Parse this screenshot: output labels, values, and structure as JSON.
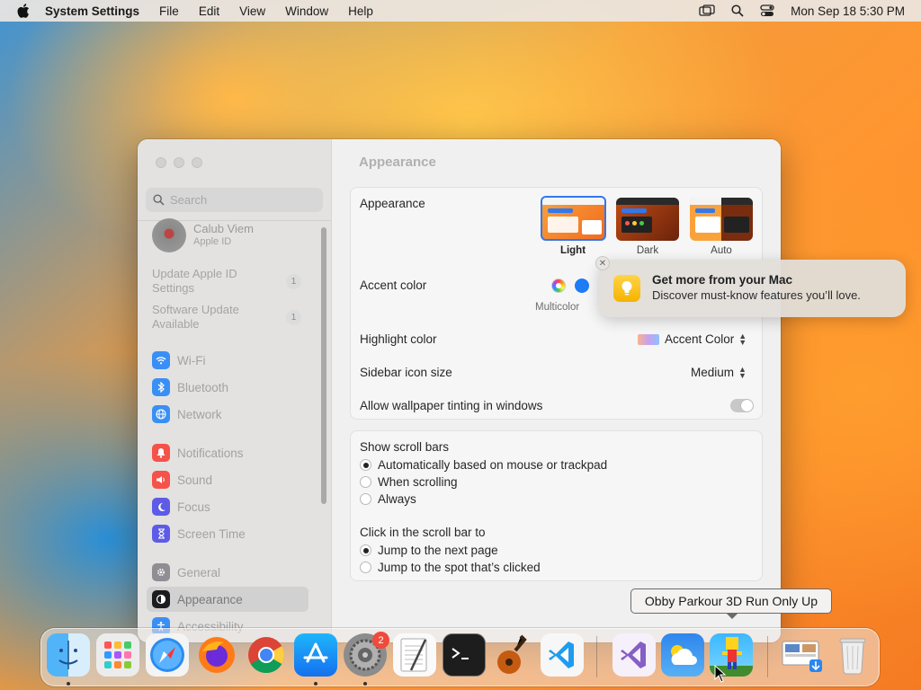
{
  "menubar": {
    "app_name": "System Settings",
    "menus": [
      "File",
      "Edit",
      "View",
      "Window",
      "Help"
    ],
    "clock": "Mon Sep 18  5:30 PM"
  },
  "sidebar": {
    "search_placeholder": "Search",
    "profile": {
      "name": "Calub Viem",
      "subtitle": "Apple ID"
    },
    "notices": [
      {
        "label": "Update Apple ID Settings",
        "badge": "1"
      },
      {
        "label": "Software Update Available",
        "badge": "1"
      }
    ],
    "items": [
      {
        "label": "Wi-Fi",
        "icon": "wifi-icon",
        "color": "#3a8ff5"
      },
      {
        "label": "Bluetooth",
        "icon": "bluetooth-icon",
        "color": "#3a8ff5"
      },
      {
        "label": "Network",
        "icon": "globe-icon",
        "color": "#3a8ff5"
      },
      {
        "label": "Notifications",
        "icon": "bell-icon",
        "color": "#f5524a"
      },
      {
        "label": "Sound",
        "icon": "speaker-icon",
        "color": "#f5524a"
      },
      {
        "label": "Focus",
        "icon": "moon-icon",
        "color": "#5e5ce6"
      },
      {
        "label": "Screen Time",
        "icon": "hourglass-icon",
        "color": "#5e5ce6"
      },
      {
        "label": "General",
        "icon": "gear-icon",
        "color": "#8e8e93"
      },
      {
        "label": "Appearance",
        "icon": "appearance-icon",
        "color": "#1c1c1e",
        "selected": true
      },
      {
        "label": "Accessibility",
        "icon": "accessibility-icon",
        "color": "#3a8ff5"
      }
    ]
  },
  "main": {
    "title": "Appearance",
    "appearance": {
      "label": "Appearance",
      "options": [
        {
          "label": "Light",
          "selected": true
        },
        {
          "label": "Dark",
          "selected": false
        },
        {
          "label": "Auto",
          "selected": false
        }
      ]
    },
    "accent": {
      "label": "Accent color",
      "caption": "Multicolor",
      "colors": [
        "multicolor",
        "#1e7cf5"
      ]
    },
    "highlight": {
      "label": "Highlight color",
      "value": "Accent Color"
    },
    "sidebar_icon": {
      "label": "Sidebar icon size",
      "value": "Medium"
    },
    "tinting": {
      "label": "Allow wallpaper tinting in windows",
      "enabled": false
    },
    "scrollbars": {
      "label": "Show scroll bars",
      "options": [
        {
          "label": "Automatically based on mouse or trackpad",
          "selected": true
        },
        {
          "label": "When scrolling",
          "selected": false
        },
        {
          "label": "Always",
          "selected": false
        }
      ]
    },
    "click_scrollbar": {
      "label": "Click in the scroll bar to",
      "options": [
        {
          "label": "Jump to the next page",
          "selected": true
        },
        {
          "label": "Jump to the spot that’s clicked",
          "selected": false
        }
      ]
    }
  },
  "notification": {
    "title": "Get more from your Mac",
    "body": "Discover must-know features you’ll love."
  },
  "tooltip": "Obby Parkour 3D Run Only Up",
  "dock": {
    "settings_badge": "2",
    "apps": [
      "Finder",
      "Launchpad",
      "Safari",
      "Firefox",
      "Chrome",
      "App Store",
      "System Settings",
      "TextEdit",
      "Terminal",
      "GarageBand",
      "Visual Studio Code",
      "Visual Studio",
      "Weather",
      "Obby Parkour 3D Run Only Up",
      "Downloads",
      "Trash"
    ]
  }
}
